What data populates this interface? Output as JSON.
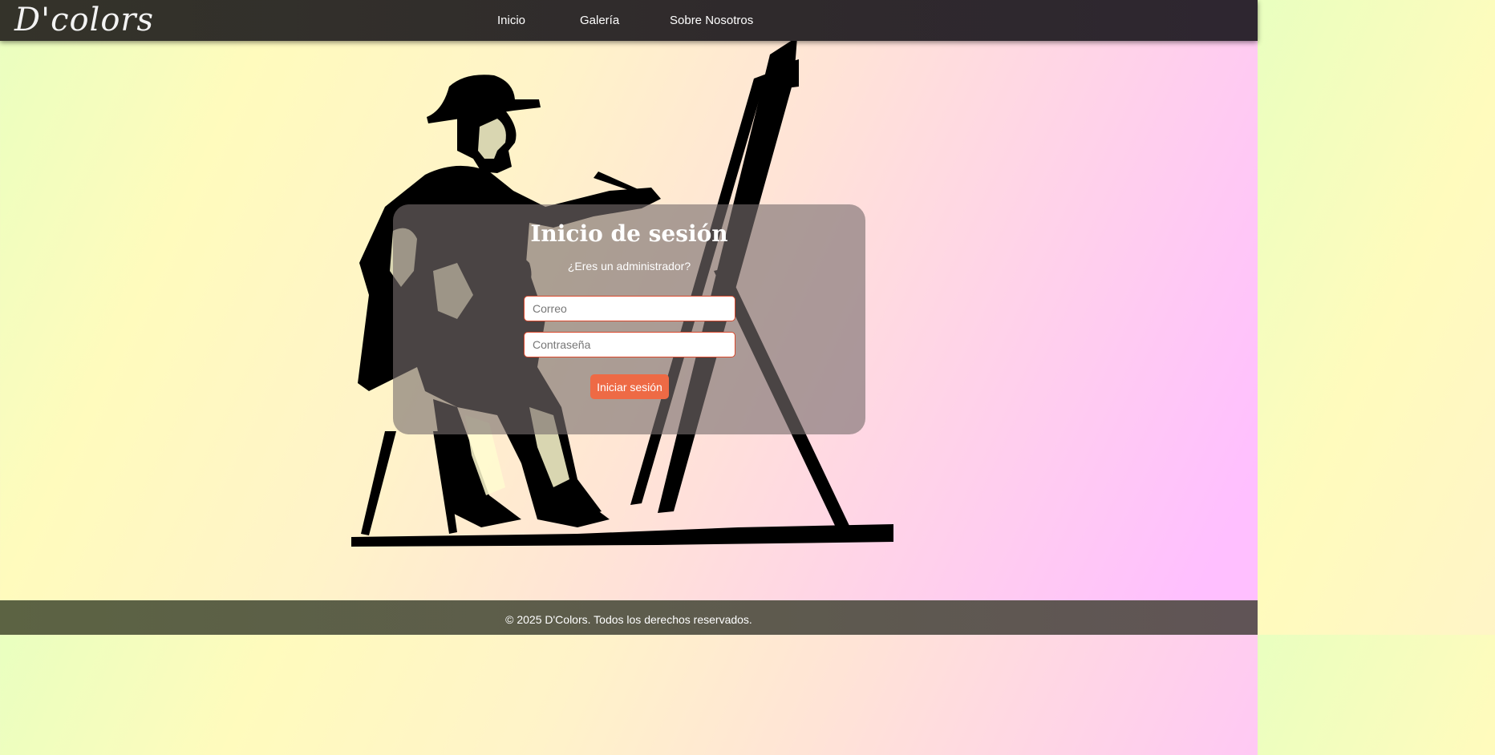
{
  "nav": {
    "brand": "D'colors",
    "links": [
      "Inicio",
      "Galería",
      "Sobre Nosotros"
    ]
  },
  "login": {
    "title": "Inicio de sesión",
    "subtitle": "¿Eres un administrador?",
    "email_placeholder": "Correo",
    "password_placeholder": "Contraseña",
    "submit_label": "Iniciar sesión"
  },
  "footer": {
    "text": "© 2025 D'Colors. Todos los derechos reservados."
  },
  "hero": {
    "icon": "painter-at-easel-illustration"
  },
  "colors": {
    "accent": "#ee6a45",
    "field_border": "#d9472b",
    "navbar": "#312c2d"
  }
}
